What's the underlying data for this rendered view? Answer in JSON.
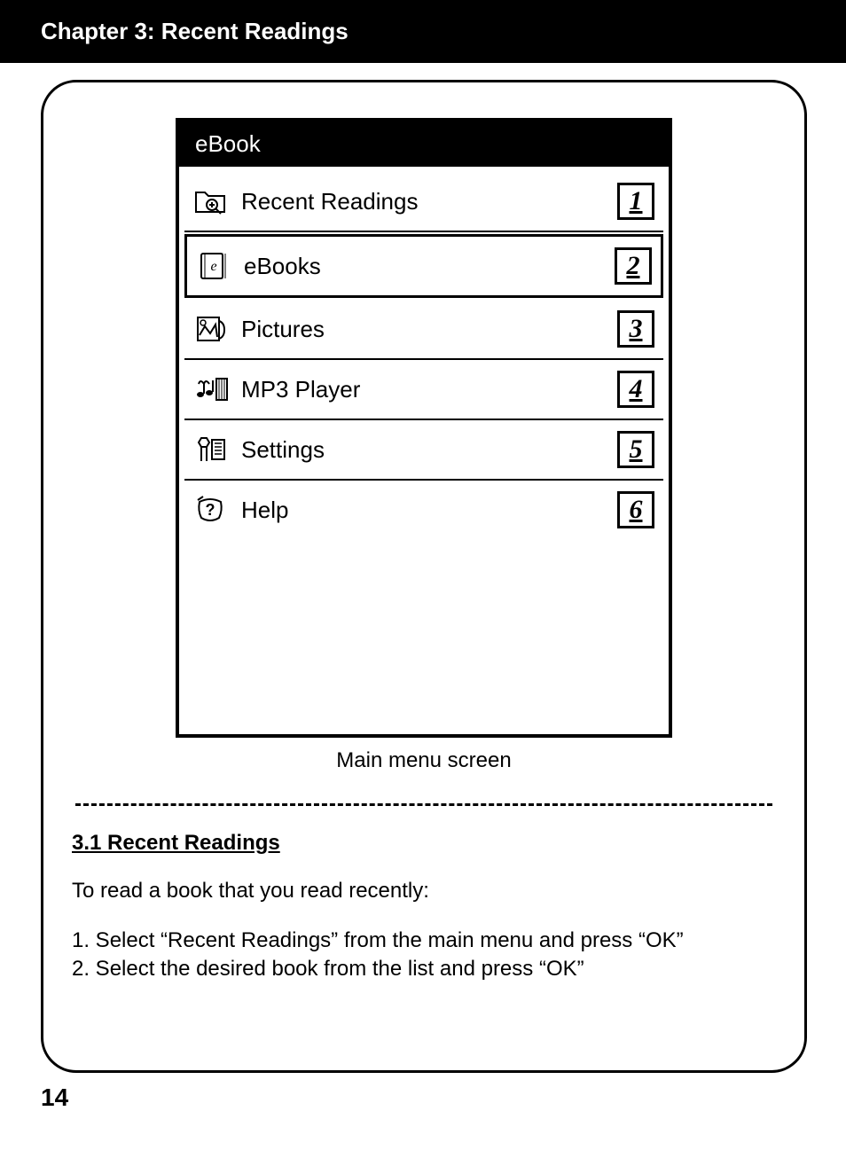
{
  "chapter_title": "Chapter 3: Recent Readings",
  "device": {
    "header": "eBook",
    "menu": [
      {
        "label": "Recent Readings",
        "num": "1",
        "icon": "recent-readings-icon",
        "selected": false
      },
      {
        "label": "eBooks",
        "num": "2",
        "icon": "ebooks-icon",
        "selected": true
      },
      {
        "label": "Pictures",
        "num": "3",
        "icon": "pictures-icon",
        "selected": false
      },
      {
        "label": "MP3 Player",
        "num": "4",
        "icon": "mp3-player-icon",
        "selected": false
      },
      {
        "label": "Settings",
        "num": "5",
        "icon": "settings-icon",
        "selected": false
      },
      {
        "label": "Help",
        "num": "6",
        "icon": "help-icon",
        "selected": false
      }
    ],
    "caption": "Main menu screen"
  },
  "section": {
    "heading": "3.1 Recent Readings",
    "intro": "To read a book that you read recently:",
    "steps": [
      "1. Select “Recent Readings” from the main menu and press “OK”",
      "2. Select the desired book from the list and press “OK”"
    ]
  },
  "page_number": "14"
}
